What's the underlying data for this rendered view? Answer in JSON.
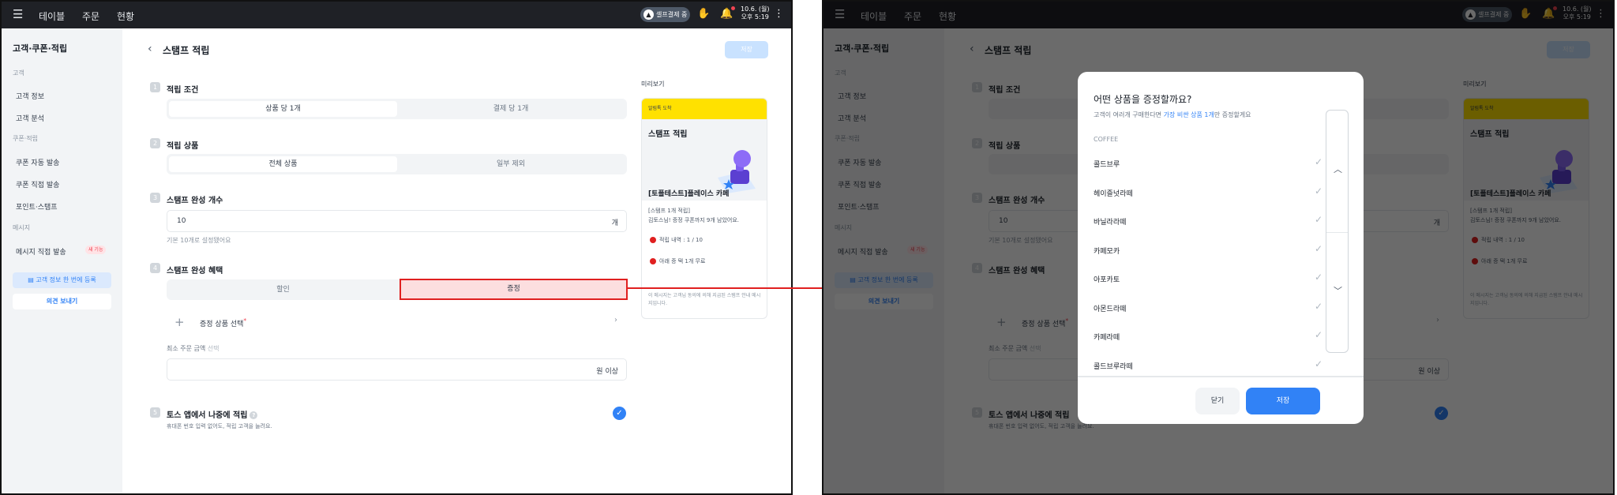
{
  "header": {
    "nav": [
      "테이블",
      "주문",
      "현황"
    ],
    "status_label": "셀프결제 중",
    "date": "10.6. (월)",
    "time": "오후 5:19"
  },
  "sidebar": {
    "title": "고객·쿠폰·적립",
    "sections": {
      "customer": "고객",
      "coupon": "쿠폰·적립",
      "message": "메시지"
    },
    "items": {
      "customer_info": "고객 정보",
      "customer_analysis": "고객 분석",
      "coupon_auto": "쿠폰 자동 발송",
      "coupon_manual": "쿠폰 직접 발송",
      "points": "포인트·스탬프",
      "message_send": "메시지 직접 발송"
    },
    "new_badge": "새 기능",
    "register_button": "고객 정보 한 번에 등록",
    "feedback_button": "의견 보내기"
  },
  "page": {
    "title": "스탬프 적립",
    "save_label": "저장",
    "steps": [
      {
        "num": "1",
        "label": "적립 조건",
        "options": [
          "상품 당 1개",
          "결제 당 1개"
        ]
      },
      {
        "num": "2",
        "label": "적립 상품",
        "options": [
          "전체 상품",
          "일부 제외"
        ]
      },
      {
        "num": "3",
        "label": "스탬프 완성 개수",
        "value": "10",
        "unit": "개",
        "hint": "기본 10개로 설정됐어요"
      },
      {
        "num": "4",
        "label": "스탬프 완성 혜택",
        "options": [
          "할인",
          "증정"
        ]
      },
      {
        "num": "5",
        "label": "토스 앱에서 나중에 적립",
        "description": "휴대폰 번호 입력 없어도, 적립 고객을 늘려요."
      }
    ],
    "gift_select_label": "증정 상품 선택",
    "min_order_label": "최소 주문 금액",
    "min_order_sub": "선택",
    "min_order_unit": "원 이상"
  },
  "preview": {
    "label": "미리보기",
    "header": "알림톡 도착",
    "card_title": "스탬프 적립",
    "shop": "[토플테스트]플레이스 카페",
    "line1": "[스탬프 1개 적립]",
    "line2": "김토스님! 증정 쿠폰까지 9개 남았어요.",
    "stat1": "적립 내역 : 1 / 10",
    "stat2": "아래 증 택 1개 무료",
    "notice": "이 메시지는 고객님 동의에 의해 지급된 스탬프 안내 메시지입니다."
  },
  "modal": {
    "title": "어떤 상품을 증정할까요?",
    "subtitle_pre": "고객이 여러개 구매한다면 ",
    "subtitle_highlight": "가장 비싼 상품 1개",
    "subtitle_post": "만 증정할게요",
    "category": "COFFEE",
    "products": [
      "콜드브루",
      "헤이즐넛라떼",
      "바닐라라떼",
      "카페모카",
      "아포카토",
      "아몬드라떼",
      "카페라떼",
      "콜드브루라떼"
    ],
    "close_label": "닫기",
    "save_label": "저장"
  },
  "colors": {
    "accent": "#3182f6",
    "topbar": "#1f2126",
    "highlight_border": "#e02020",
    "preview_header": "#ffe100"
  }
}
